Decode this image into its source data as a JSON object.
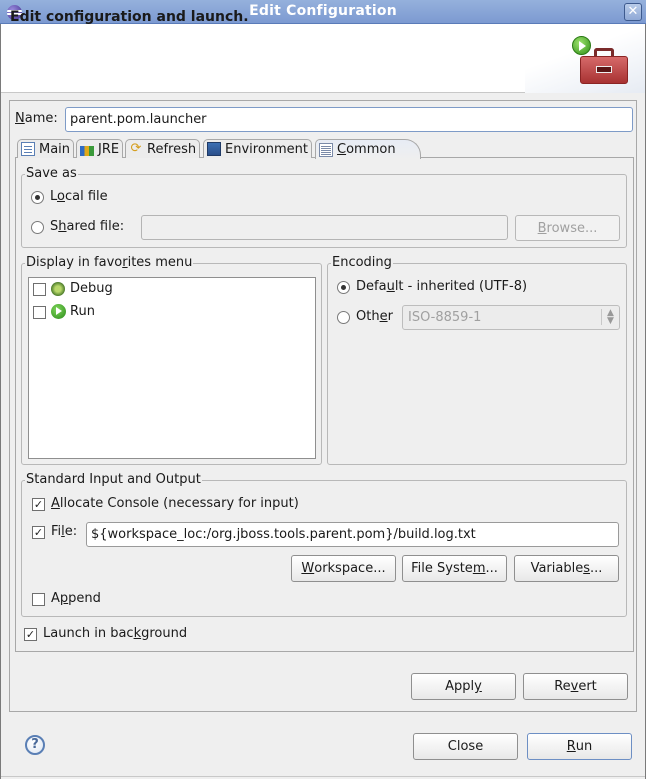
{
  "window": {
    "title": "Edit Configuration",
    "close_glyph": "✕"
  },
  "header": {
    "title": "Edit configuration and launch."
  },
  "name_field": {
    "label_mnemonic": "N",
    "label_rest": "ame:",
    "value": "parent.pom.launcher"
  },
  "tabs": [
    {
      "label": "Main",
      "icon": "main-tab-icon",
      "active": false
    },
    {
      "label": "JRE",
      "icon": "jre-icon",
      "active": false
    },
    {
      "label": "Refresh",
      "icon": "refresh-icon",
      "active": false
    },
    {
      "label": "Environment",
      "icon": "environment-icon",
      "active": false
    },
    {
      "label": "Common",
      "icon": "common-icon",
      "active": true,
      "mnemonic": "C",
      "rest": "ommon"
    }
  ],
  "save_as": {
    "title": "Save as",
    "local_file": {
      "pre": "L",
      "mn": "o",
      "post": "cal file",
      "checked": true
    },
    "shared_file": {
      "pre": "S",
      "mn": "h",
      "post": "ared file:",
      "checked": false,
      "value": ""
    },
    "browse": {
      "mn": "B",
      "post": "rowse..."
    }
  },
  "favorites": {
    "title_pre": "Display in favo",
    "title_mn": "r",
    "title_post": "ites menu",
    "items": [
      {
        "label": "Debug",
        "icon": "debug-icon",
        "checked": false
      },
      {
        "label": "Run",
        "icon": "run-icon",
        "checked": false
      }
    ]
  },
  "encoding": {
    "title": "Encoding",
    "default": {
      "pre": "Defa",
      "mn": "u",
      "post": "lt - inherited (UTF-8)",
      "checked": true
    },
    "other": {
      "pre": "Oth",
      "mn": "e",
      "post": "r",
      "checked": false
    },
    "other_value": "ISO-8859-1"
  },
  "std_io": {
    "title": "Standard Input and Output",
    "allocate_console": {
      "mn": "A",
      "post": "llocate Console (necessary for input)",
      "checked": true
    },
    "file": {
      "pre": "Fi",
      "mn": "l",
      "post": "e:",
      "checked": true,
      "value": "${workspace_loc:/org.jboss.tools.parent.pom}/build.log.txt"
    },
    "workspace_btn": {
      "mn": "W",
      "post": "orkspace..."
    },
    "filesystem_btn": {
      "pre": "File Syste",
      "mn": "m",
      "post": "..."
    },
    "variables_btn": {
      "pre": "Variable",
      "mn": "s",
      "post": "..."
    },
    "append": {
      "pre": "A",
      "mn": "p",
      "post": "pend",
      "checked": false
    }
  },
  "launch_background": {
    "pre": "Launch in bac",
    "mn": "k",
    "post": "ground",
    "checked": true
  },
  "buttons": {
    "apply": {
      "pre": "Appl",
      "mn": "y",
      "post": ""
    },
    "revert": {
      "pre": "Re",
      "mn": "v",
      "post": "ert"
    },
    "close": "Close",
    "run": {
      "mn": "R",
      "post": "un"
    }
  },
  "check_glyph": "✓",
  "help_glyph": "?"
}
